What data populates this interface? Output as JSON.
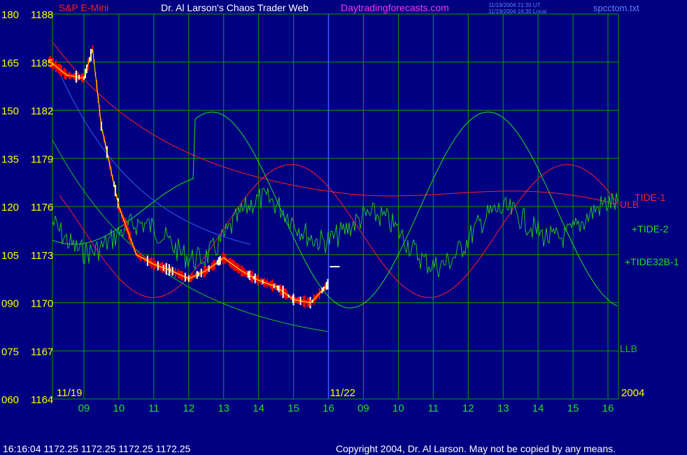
{
  "header": {
    "title_left": "S&P E-Mini",
    "title_main": "Dr. Al Larson's Chaos Trader Web",
    "site": "Daytradingforecasts.com",
    "stamp_utc": "11/19/2004 21:30 UT",
    "stamp_local": "11/19/2004 16:30 Local",
    "file": "spcctom.txt"
  },
  "footer": {
    "quote": "16:16:04  1172.25 1172.25 1172.25 1172.25",
    "copyright": "Copyright 2004, Dr. Al Larson. May not be copied by any means."
  },
  "colors": {
    "background": "#000080",
    "grid": "#00a000",
    "price_up": "#ffffff",
    "price_down": "#ff0000",
    "average": "#ffff00",
    "tide1": "#ff2020",
    "tide2": "#20e020",
    "tide32": "#20c020",
    "llb": "#20c020",
    "blue_line": "#3060ff",
    "session_divider": "#4060ff",
    "left_labels": "#ffff00",
    "bottom_labels": "#20e020",
    "title": "#ffffff",
    "site": "#ff30ff",
    "stamp": "#6080ff"
  },
  "chart_data": {
    "type": "line",
    "title": "Dr. Al Larson's Chaos Trader Web",
    "y_left_outer": [
      "180",
      "165",
      "150",
      "135",
      "120",
      "105",
      "090",
      "075",
      "060"
    ],
    "y_left_inner": [
      "1188",
      "1185",
      "1182",
      "1179",
      "1176",
      "1173",
      "1170",
      "1167",
      "1164"
    ],
    "price_range": [
      1164,
      1188
    ],
    "x_day_labels": [
      "11/19",
      "11/22",
      "2004"
    ],
    "x_hour_labels": [
      "09",
      "10",
      "11",
      "12",
      "13",
      "14",
      "15",
      "16",
      "09",
      "10",
      "11",
      "12",
      "13",
      "14",
      "15",
      "16"
    ],
    "x_axis_hours": [
      8.0,
      16.0
    ],
    "session_divider_day": 1,
    "price_ohlc_hourly_11_19": [
      {
        "t": "08:00",
        "price": 1185.1
      },
      {
        "t": "08:30",
        "price": 1184.2
      },
      {
        "t": "09:00",
        "price": 1184.0
      },
      {
        "t": "09:15",
        "price": 1185.8
      },
      {
        "t": "09:30",
        "price": 1181.0
      },
      {
        "t": "10:00",
        "price": 1176.0
      },
      {
        "t": "10:30",
        "price": 1173.0
      },
      {
        "t": "11:00",
        "price": 1172.4
      },
      {
        "t": "11:30",
        "price": 1172.0
      },
      {
        "t": "12:00",
        "price": 1171.5
      },
      {
        "t": "12:30",
        "price": 1172.0
      },
      {
        "t": "13:00",
        "price": 1172.8
      },
      {
        "t": "13:30",
        "price": 1172.0
      },
      {
        "t": "14:00",
        "price": 1171.4
      },
      {
        "t": "14:30",
        "price": 1171.0
      },
      {
        "t": "15:00",
        "price": 1170.2
      },
      {
        "t": "15:30",
        "price": 1170.0
      },
      {
        "t": "16:00",
        "price": 1171.2
      }
    ],
    "last_price": 1172.25,
    "series": [
      {
        "name": "TIDE-1"
      },
      {
        "name": "+TIDE-2"
      },
      {
        "name": "+TIDE32B-1"
      },
      {
        "name": "ULB"
      },
      {
        "name": "LLB"
      }
    ],
    "grid": true
  }
}
